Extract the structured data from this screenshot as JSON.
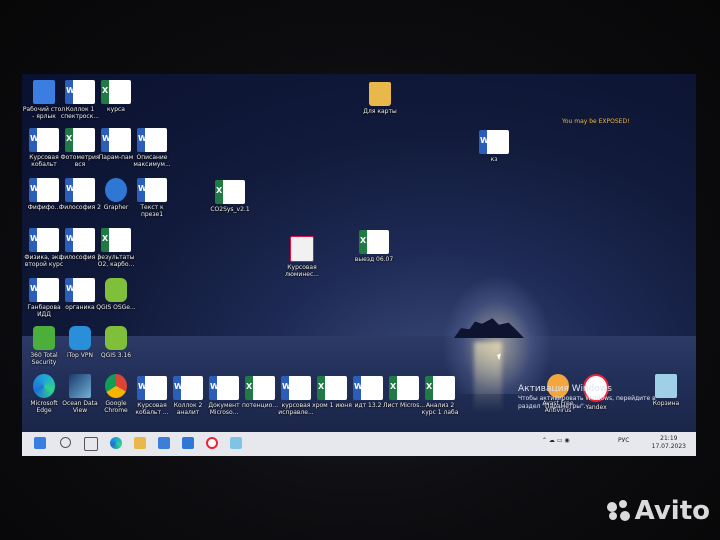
{
  "desktop": {
    "icons": [
      {
        "name": "icon-desktop-shortcut",
        "type": "app-win",
        "label": "Рабочий стол - ярлык"
      },
      {
        "name": "icon-kollok1",
        "type": "word",
        "label": "Коллок 1 спектроск..."
      },
      {
        "name": "icon-kursa",
        "type": "excel",
        "label": "курса"
      },
      {
        "name": "icon-folder-cards",
        "type": "folder",
        "label": "Для карты"
      },
      {
        "name": "icon-kursovaya-kobalt",
        "type": "word",
        "label": "Курсовая кобальт"
      },
      {
        "name": "icon-fotometriya",
        "type": "excel",
        "label": "Фотометрия вся"
      },
      {
        "name": "icon-param-pam",
        "type": "word",
        "label": "Парам-пам"
      },
      {
        "name": "icon-opisanie",
        "type": "word",
        "label": "Описание максимум..."
      },
      {
        "name": "icon-k3",
        "type": "word",
        "label": "кз"
      },
      {
        "name": "icon-filosofiya1",
        "type": "word",
        "label": "Фифифо..."
      },
      {
        "name": "icon-filosofiya2",
        "type": "word",
        "label": "Философия 2"
      },
      {
        "name": "icon-grapher",
        "type": "app-blue",
        "label": "Grapher"
      },
      {
        "name": "icon-tekst-prez",
        "type": "word",
        "label": "Текст к презе1"
      },
      {
        "name": "icon-co2sys",
        "type": "excel",
        "label": "CO2Sys_v2.1"
      },
      {
        "name": "icon-fizika",
        "type": "word",
        "label": "Физика, экз, второй курс"
      },
      {
        "name": "icon-filosofiya3",
        "type": "word",
        "label": "философия 3"
      },
      {
        "name": "icon-rezultaty",
        "type": "excel",
        "label": "результаты O2, карбо..."
      },
      {
        "name": "icon-kursovaya-lum",
        "type": "pptx",
        "label": "Курсовая люминес..."
      },
      {
        "name": "icon-vyezd",
        "type": "excel",
        "label": "выезд 06.07"
      },
      {
        "name": "icon-ganbarova",
        "type": "word",
        "label": "Ганбарова ИДД"
      },
      {
        "name": "icon-organika",
        "type": "word",
        "label": "органика"
      },
      {
        "name": "icon-qgis-osge",
        "type": "app-qgis",
        "label": "QGIS OSGe..."
      },
      {
        "name": "icon-360",
        "type": "app-green",
        "label": "360 Total Security"
      },
      {
        "name": "icon-itop",
        "type": "app-itop",
        "label": "iTop VPN"
      },
      {
        "name": "icon-qgis316",
        "type": "app-qgis",
        "label": "QGIS 3.16"
      },
      {
        "name": "icon-edge",
        "type": "app-edge",
        "label": "Microsoft Edge"
      },
      {
        "name": "icon-ocean",
        "type": "app-ocean",
        "label": "Ocean Data View"
      },
      {
        "name": "icon-chrome",
        "type": "app-chrome",
        "label": "Google Chrome"
      },
      {
        "name": "icon-kursovaya-kobalt2",
        "type": "word",
        "label": "Курсовая кобальт ..."
      },
      {
        "name": "icon-kollok2",
        "type": "word",
        "label": "Коллок 2 аналит"
      },
      {
        "name": "icon-dokument",
        "type": "word",
        "label": "Документ Microso..."
      },
      {
        "name": "icon-potencio",
        "type": "excel",
        "label": "потенцио..."
      },
      {
        "name": "icon-kursovaya-ispr",
        "type": "word",
        "label": "курсовая исправле..."
      },
      {
        "name": "icon-hrom",
        "type": "excel",
        "label": "хром 1 июня"
      },
      {
        "name": "icon-idt",
        "type": "word",
        "label": "идт 13.2"
      },
      {
        "name": "icon-list",
        "type": "excel",
        "label": "Лист Micros..."
      },
      {
        "name": "icon-analit2",
        "type": "excel",
        "label": "Анализ 2 курс 1 лаба"
      },
      {
        "name": "icon-avast",
        "type": "app-avast",
        "label": "Avast Free Antivirus"
      },
      {
        "name": "icon-yandex",
        "type": "app-yandex",
        "label": "Yandex"
      },
      {
        "name": "icon-recycle",
        "type": "app-trash",
        "label": "Корзина"
      }
    ]
  },
  "widget": {
    "exposed": "You may be EXPOSED!"
  },
  "activation": {
    "title": "Активация Windows",
    "line1": "Чтобы активировать Windows, перейдите в",
    "line2": "раздел \"Параметры\"."
  },
  "taskbar": {
    "lang": "РУС",
    "time": "21:19",
    "date": "17.07.2023"
  },
  "watermark": {
    "brand": "Avito"
  }
}
